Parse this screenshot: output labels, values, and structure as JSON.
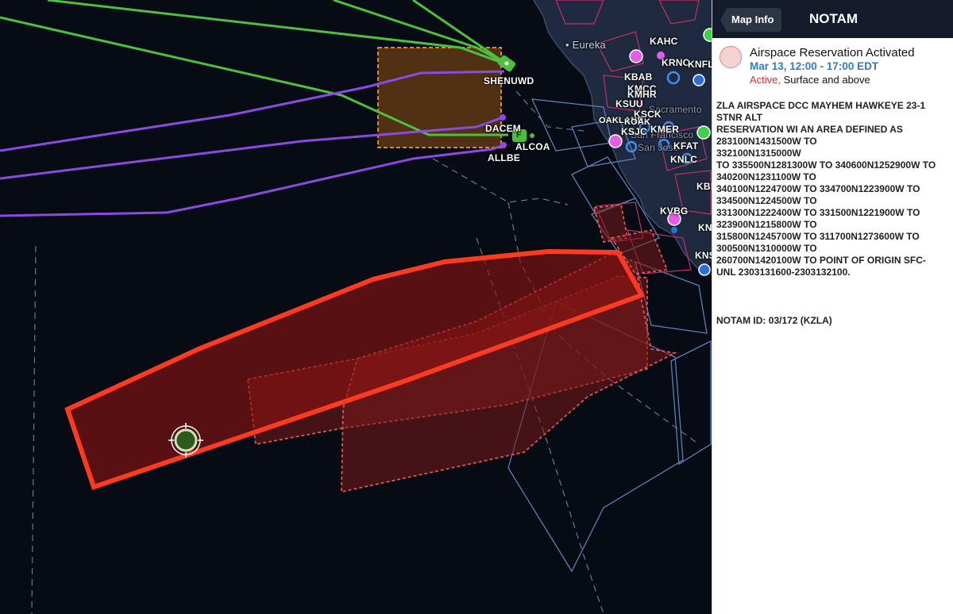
{
  "panel": {
    "back_label": "Map Info",
    "title": "NOTAM",
    "reservation_title": "Airspace Reservation Activated",
    "time": "Mar 13, 12:00 - 17:00 EDT",
    "status_word": "Active,",
    "status_rest": " Surface and above",
    "notam_body": "ZLA AIRSPACE DCC MAYHEM HAWKEYE 23-1\nSTNR ALT\nRESERVATION WI AN AREA DEFINED AS\n283100N1431500W TO\n332100N1315000W\nTO 335500N1281300W TO 340600N1252900W TO\n340200N1231100W TO\n340100N1224700W TO 334700N1223900W TO\n334500N1224500W TO\n331300N1222400W TO 331500N1221900W TO\n323900N1215800W TO\n315800N1245700W TO 311700N1273600W TO\n300500N1310000W TO\n260700N1420100W TO POINT OF ORIGIN SFC-\nUNL 2303131600-2303132100.",
    "notam_id": "NOTAM ID: 03/172 (KZLA)"
  },
  "map": {
    "waypoints": {
      "shenu": "SHENU",
      "wd": "WD",
      "dacem": "DACEM",
      "alcoa": "ALCOA",
      "allbe": "ALLBE",
      "f": "F"
    },
    "airports": {
      "kahc": "KAHC",
      "krno": "KRNO",
      "knfl": "KNFL",
      "kbab": "KBAB",
      "kmcc": "KMCC",
      "kmhr": "KMHR",
      "ksuu": "KSUU",
      "ksck": "KSCK",
      "oakland": "OAKLAND",
      "koak": "KOAK",
      "ksjc": "KSJC",
      "kmer": "KMER",
      "kfat": "KFAT",
      "knlc": "KNLC",
      "kbf": "KBF",
      "kvbg": "KVBG",
      "kn": "KN",
      "kns": "KNS"
    },
    "cities": {
      "eureka": "Eureka",
      "sacramento": "Sacramento",
      "san_francisco": "San Francisco",
      "san_jose": "San Jose"
    },
    "colors": {
      "notam_highlight": "#ff3b1f",
      "restricted_fill": "#7a1a1a",
      "route_green": "#4cc13d",
      "route_purple": "#8c4ae0",
      "airspace_blue": "#5d7fb8",
      "special_use_magenta": "#d6336c",
      "mil_orange": "#d98a2b"
    }
  }
}
